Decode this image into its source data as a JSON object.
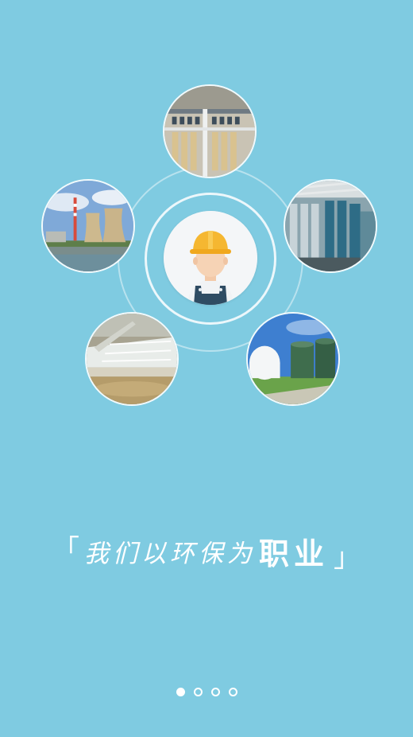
{
  "onboarding": {
    "slogan": {
      "open_bracket": "「",
      "main_text": "我们以环保为",
      "emphasis_text": "职业",
      "close_bracket": "」"
    },
    "pager": {
      "total_pages": 4,
      "current_page": 1
    },
    "images": [
      {
        "name": "membrane-filtration-plant-photo"
      },
      {
        "name": "water-treatment-pipes-photo"
      },
      {
        "name": "cooling-towers-power-plant-photo"
      },
      {
        "name": "sewage-clarifier-tank-photo"
      },
      {
        "name": "biogas-storage-tanks-photo"
      }
    ],
    "center_icon": "construction-worker-icon"
  },
  "colors": {
    "background": "#7fcbe1",
    "ring": "#ffffff",
    "helmet": "#f5b731",
    "overalls": "#2f4c63"
  }
}
